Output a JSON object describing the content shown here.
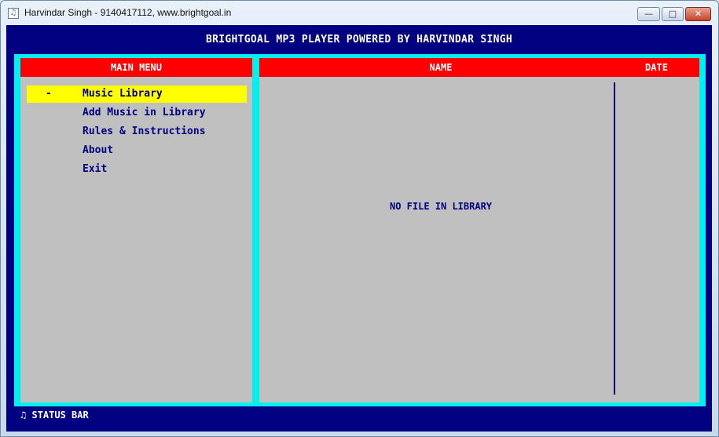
{
  "window": {
    "title": "Harvindar Singh - 9140417112, www.brightgoal.in",
    "icon": "music-note-icon",
    "minimize_symbol": "—",
    "maximize_symbol": "□",
    "close_symbol": "✕"
  },
  "app": {
    "title": "BRIGHTGOAL MP3 PLAYER POWERED BY HARVINDAR SINGH"
  },
  "menu": {
    "header": "MAIN MENU",
    "bullet": "-",
    "items": [
      {
        "label": "Music Library",
        "selected": true
      },
      {
        "label": "Add Music in Library",
        "selected": false
      },
      {
        "label": "Rules & Instructions",
        "selected": false
      },
      {
        "label": "About",
        "selected": false
      },
      {
        "label": "Exit",
        "selected": false
      }
    ]
  },
  "library": {
    "columns": [
      "NAME",
      "DATE"
    ],
    "empty_message": "NO FILE IN LIBRARY"
  },
  "status_bar": {
    "icon": "♫",
    "text": "STATUS BAR"
  },
  "colors": {
    "background": "#000080",
    "frame": "#00f0f0",
    "header": "#ff0000",
    "panel": "#c0c0c0",
    "highlight": "#ffff00"
  }
}
